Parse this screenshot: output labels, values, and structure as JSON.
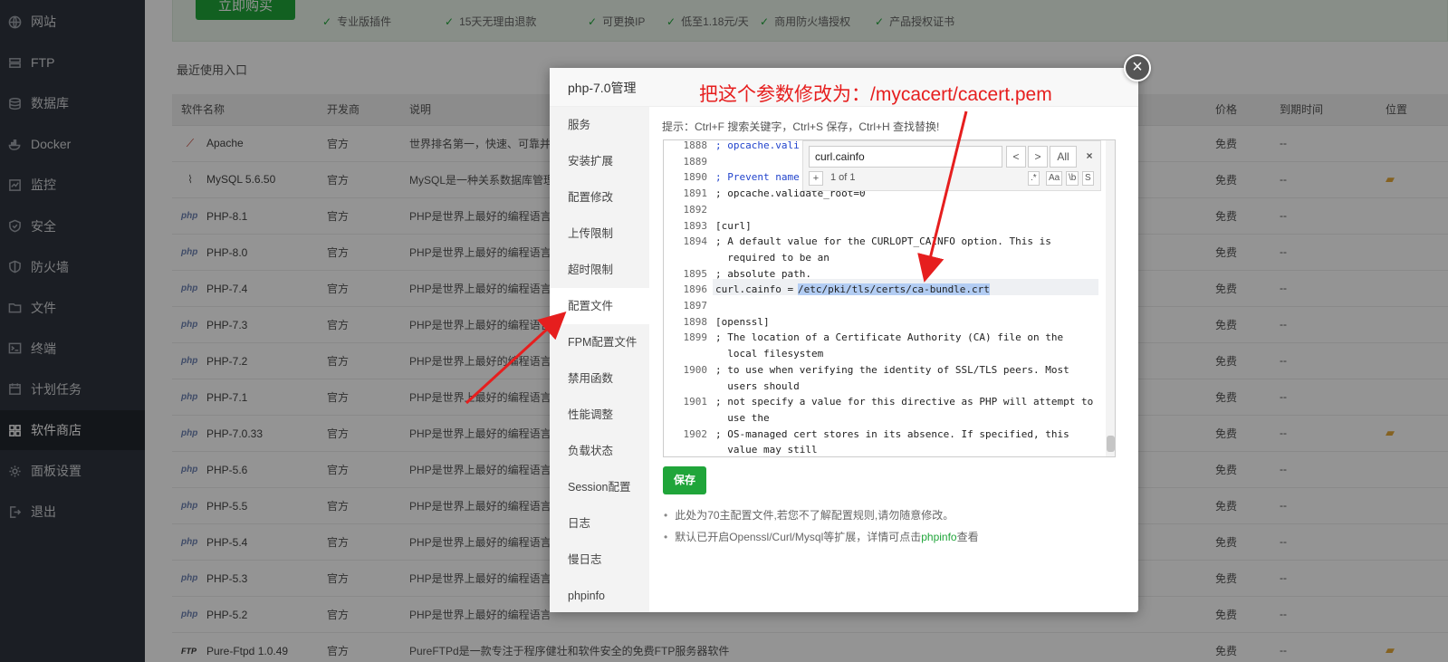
{
  "sidebar": {
    "items": [
      {
        "label": "网站",
        "icon": "globe-icon"
      },
      {
        "label": "FTP",
        "icon": "ftp-icon"
      },
      {
        "label": "数据库",
        "icon": "database-icon"
      },
      {
        "label": "Docker",
        "icon": "docker-icon"
      },
      {
        "label": "监控",
        "icon": "monitor-icon"
      },
      {
        "label": "安全",
        "icon": "shield-icon"
      },
      {
        "label": "防火墙",
        "icon": "firewall-icon"
      },
      {
        "label": "文件",
        "icon": "folder-icon"
      },
      {
        "label": "终端",
        "icon": "terminal-icon"
      },
      {
        "label": "计划任务",
        "icon": "calendar-icon"
      },
      {
        "label": "软件商店",
        "icon": "grid-icon"
      },
      {
        "label": "面板设置",
        "icon": "gear-icon"
      },
      {
        "label": "退出",
        "icon": "logout-icon"
      }
    ],
    "active_index": 10
  },
  "banner": {
    "buy_label": "立即购买",
    "features": [
      "专业版插件",
      "15天无理由退款",
      "可更换IP",
      "低至1.18元/天",
      "商用防火墙授权",
      "产品授权证书"
    ]
  },
  "recent_label": "最近使用入口",
  "table": {
    "headers": [
      "软件名称",
      "开发商",
      "说明",
      "价格",
      "到期时间",
      "位置"
    ],
    "rows": [
      {
        "name": "Apache",
        "logo": "apache",
        "dev": "官方",
        "desc": "世界排名第一，快速、可靠并",
        "price": "免费",
        "expire": "--",
        "folder": false
      },
      {
        "name": "MySQL 5.6.50",
        "logo": "mysql",
        "dev": "官方",
        "desc": "MySQL是一种关系数据库管理",
        "price": "免费",
        "expire": "--",
        "folder": true
      },
      {
        "name": "PHP-8.1",
        "logo": "php",
        "dev": "官方",
        "desc": "PHP是世界上最好的编程语言",
        "price": "免费",
        "expire": "--",
        "folder": false
      },
      {
        "name": "PHP-8.0",
        "logo": "php",
        "dev": "官方",
        "desc": "PHP是世界上最好的编程语言",
        "price": "免费",
        "expire": "--",
        "folder": false
      },
      {
        "name": "PHP-7.4",
        "logo": "php",
        "dev": "官方",
        "desc": "PHP是世界上最好的编程语言",
        "price": "免费",
        "expire": "--",
        "folder": false
      },
      {
        "name": "PHP-7.3",
        "logo": "php",
        "dev": "官方",
        "desc": "PHP是世界上最好的编程语言",
        "price": "免费",
        "expire": "--",
        "folder": false
      },
      {
        "name": "PHP-7.2",
        "logo": "php",
        "dev": "官方",
        "desc": "PHP是世界上最好的编程语言",
        "price": "免费",
        "expire": "--",
        "folder": false
      },
      {
        "name": "PHP-7.1",
        "logo": "php",
        "dev": "官方",
        "desc": "PHP是世界上最好的编程语言",
        "price": "免费",
        "expire": "--",
        "folder": false
      },
      {
        "name": "PHP-7.0.33",
        "logo": "php",
        "dev": "官方",
        "desc": "PHP是世界上最好的编程语言",
        "price": "免费",
        "expire": "--",
        "folder": true
      },
      {
        "name": "PHP-5.6",
        "logo": "php",
        "dev": "官方",
        "desc": "PHP是世界上最好的编程语言",
        "price": "免费",
        "expire": "--",
        "folder": false
      },
      {
        "name": "PHP-5.5",
        "logo": "php",
        "dev": "官方",
        "desc": "PHP是世界上最好的编程语言",
        "price": "免费",
        "expire": "--",
        "folder": false
      },
      {
        "name": "PHP-5.4",
        "logo": "php",
        "dev": "官方",
        "desc": "PHP是世界上最好的编程语言",
        "price": "免费",
        "expire": "--",
        "folder": false
      },
      {
        "name": "PHP-5.3",
        "logo": "php",
        "dev": "官方",
        "desc": "PHP是世界上最好的编程语言",
        "price": "免费",
        "expire": "--",
        "folder": false
      },
      {
        "name": "PHP-5.2",
        "logo": "php",
        "dev": "官方",
        "desc": "PHP是世界上最好的编程语言",
        "price": "免费",
        "expire": "--",
        "folder": false
      },
      {
        "name": "Pure-Ftpd 1.0.49",
        "logo": "ftp",
        "dev": "官方",
        "desc": "PureFTPd是一款专注于程序健壮和软件安全的免费FTP服务器软件",
        "price": "免费",
        "expire": "--",
        "folder": true
      }
    ],
    "php_logo_text": "php",
    "ftp_logo_text": "FTP"
  },
  "modal": {
    "title": "php-7.0管理",
    "close_symbol": "×",
    "nav": [
      "服务",
      "安装扩展",
      "配置修改",
      "上传限制",
      "超时限制",
      "配置文件",
      "FPM配置文件",
      "禁用函数",
      "性能调整",
      "负载状态",
      "Session配置",
      "日志",
      "慢日志",
      "phpinfo"
    ],
    "active_nav": 5,
    "hint": "提示：Ctrl+F 搜索关键字，Ctrl+S 保存，Ctrl+H 查找替换!",
    "search": {
      "value": "curl.cainfo",
      "prev": "<",
      "next": ">",
      "all": "All",
      "close": "×",
      "plus": "+",
      "count": "1 of 1",
      "opt_regex": ".*",
      "opt_case": "Aa",
      "opt_word": "\\b",
      "opt_sel": "S"
    },
    "editor_lines": [
      {
        "no": "1888",
        "text": "; opcache.vali"
      },
      {
        "no": "1889",
        "text": ""
      },
      {
        "no": "1890",
        "text": "; Prevent name"
      },
      {
        "no": "1891",
        "text": "; opcache.validate_root=0"
      },
      {
        "no": "1892",
        "text": ""
      },
      {
        "no": "1893",
        "text": "[curl]"
      },
      {
        "no": "1894",
        "text": "; A default value for the CURLOPT_CAINFO option. This is"
      },
      {
        "no": "",
        "text": "  required to be an"
      },
      {
        "no": "1895",
        "text": "; absolute path."
      },
      {
        "no": "1896",
        "text": "curl.cainfo = "
      },
      {
        "no": "1897",
        "text": ""
      },
      {
        "no": "1898",
        "text": "[openssl]"
      },
      {
        "no": "1899",
        "text": "; The location of a Certificate Authority (CA) file on the"
      },
      {
        "no": "",
        "text": "  local filesystem"
      },
      {
        "no": "1900",
        "text": "; to use when verifying the identity of SSL/TLS peers. Most"
      },
      {
        "no": "",
        "text": "  users should"
      },
      {
        "no": "1901",
        "text": "; not specify a value for this directive as PHP will attempt to"
      },
      {
        "no": "",
        "text": "  use the"
      },
      {
        "no": "1902",
        "text": "; OS-managed cert stores in its absence. If specified, this"
      },
      {
        "no": "",
        "text": "  value may still"
      }
    ],
    "selected_path": "/etc/pki/tls/certs/ca-bundle.crt",
    "save_label": "保存",
    "tip1": "此处为70主配置文件,若您不了解配置规则,请勿随意修改。",
    "tip2_prefix": "默认已开启Openssl/Curl/Mysql等扩展，详情可点击",
    "tip2_link": "phpinfo",
    "tip2_suffix": "查看"
  },
  "annotation": {
    "text": "把这个参数修改为：/mycacert/cacert.pem",
    "color": "#e61e1e"
  },
  "colors": {
    "accent_green": "#20a53a",
    "sidebar_bg": "#30353e"
  }
}
